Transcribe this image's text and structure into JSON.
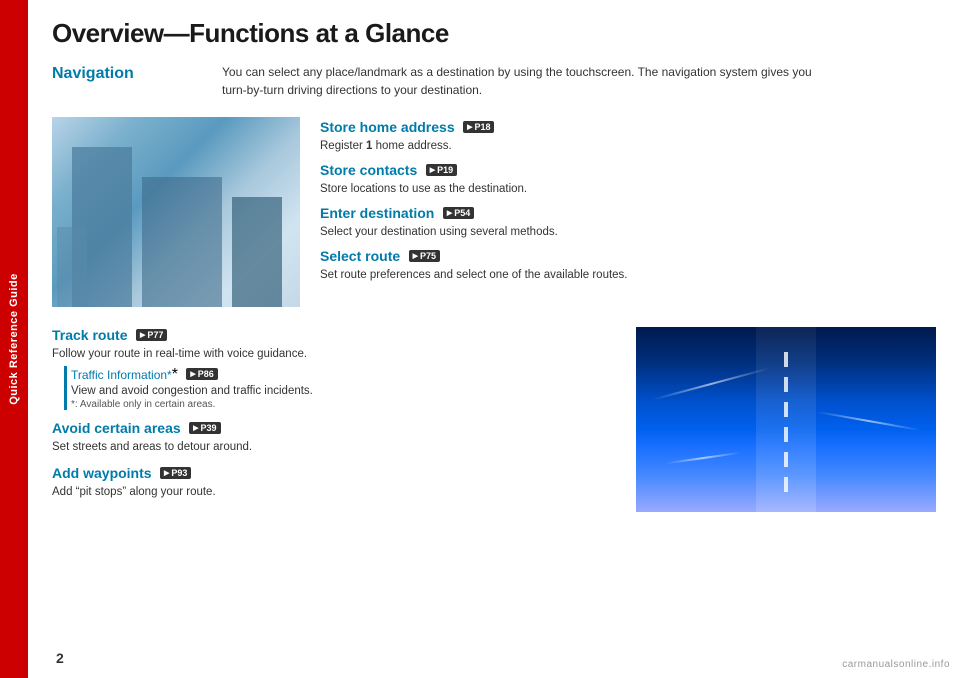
{
  "sidebar": {
    "label": "Quick Reference Guide"
  },
  "page": {
    "title": "Overview—Functions at a Glance",
    "number": "2",
    "watermark": "carmanualsonline.info"
  },
  "navigation_section": {
    "label": "Navigation",
    "description_line1": "You can select any place/landmark as a destination by using the touchscreen. The navigation system gives you",
    "description_line2": "turn-by-turn driving directions to your destination."
  },
  "features_upper": [
    {
      "title": "Store home address",
      "badge": "P18",
      "description": "Register 1 home address."
    },
    {
      "title": "Store contacts",
      "badge": "P19",
      "description": "Store locations to use as the destination."
    },
    {
      "title": "Enter destination",
      "badge": "P54",
      "description": "Select your destination using several methods."
    },
    {
      "title": "Select route",
      "badge": "P75",
      "description": "Set route preferences and select one of the available routes."
    }
  ],
  "features_lower": [
    {
      "title": "Track route",
      "badge": "P77",
      "description": "Follow your route in real-time with voice guidance.",
      "sub_feature": {
        "title": "Traffic Information*",
        "badge": "P86",
        "description": "View and avoid congestion and traffic incidents.",
        "note": "*: Available only in certain areas."
      }
    },
    {
      "title": "Avoid certain areas",
      "badge": "P39",
      "description": "Set streets and areas to detour around."
    },
    {
      "title": "Add waypoints",
      "badge": "P93",
      "description": "Add “pit stops” along your route."
    }
  ]
}
